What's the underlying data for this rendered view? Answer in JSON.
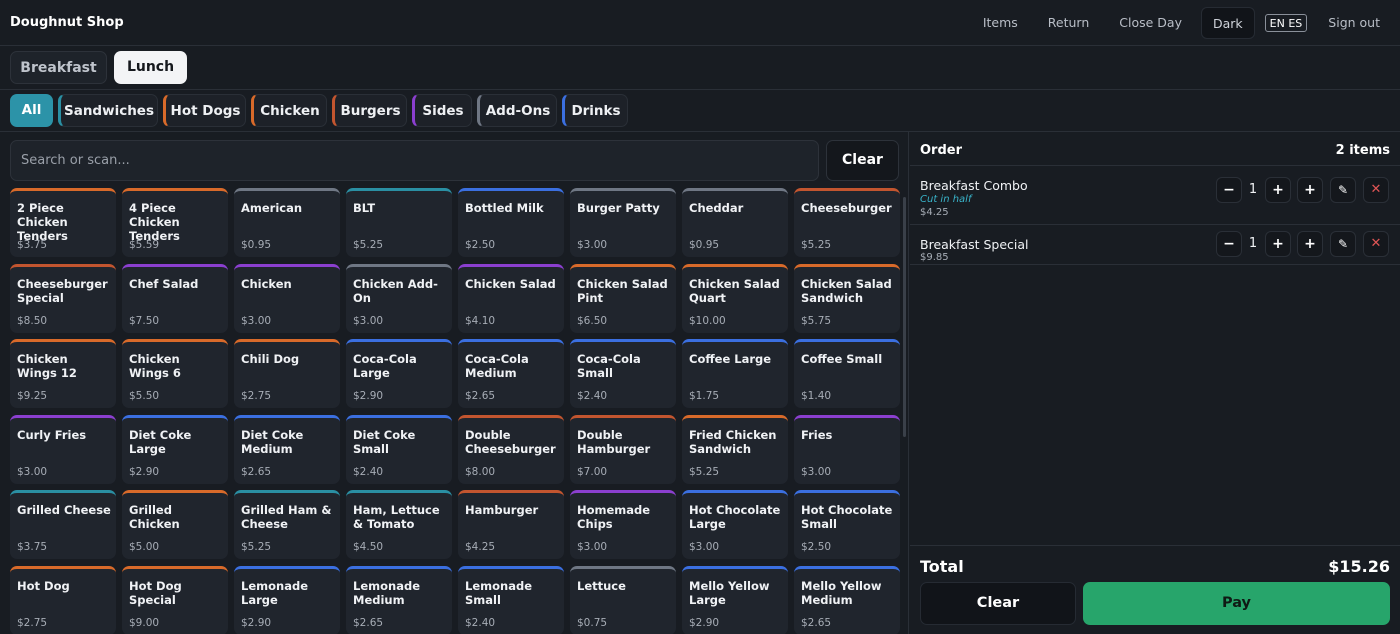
{
  "app": {
    "title": "Doughnut Shop"
  },
  "nav": {
    "items": "Items",
    "return": "Return",
    "close_day": "Close Day",
    "theme": "Dark",
    "lang": "EN ES",
    "sign_out": "Sign out"
  },
  "meals": {
    "breakfast": "Breakfast",
    "lunch": "Lunch"
  },
  "categories": [
    {
      "label": "All",
      "color": "#2c93a8"
    },
    {
      "label": "Sandwiches",
      "color": "#2a8fa3"
    },
    {
      "label": "Hot Dogs",
      "color": "#d86a2a"
    },
    {
      "label": "Chicken",
      "color": "#d86a2a"
    },
    {
      "label": "Burgers",
      "color": "#c2552f"
    },
    {
      "label": "Sides",
      "color": "#8b3fcf"
    },
    {
      "label": "Add-Ons",
      "color": "#6f7784"
    },
    {
      "label": "Drinks",
      "color": "#3b6fe0"
    }
  ],
  "search": {
    "placeholder": "Search or scan...",
    "clear_label": "Clear"
  },
  "colors": {
    "sandwich": "#2a8fa3",
    "chicken": "#d86a2a",
    "burger": "#c2552f",
    "side": "#8b3fcf",
    "addon": "#6f7784",
    "drink": "#3b6fe0",
    "pay": "#27a56b",
    "remove": "#e05555"
  },
  "products": [
    {
      "name": "2 Piece Chicken Tenders",
      "price": "$3.75",
      "cat": "chicken"
    },
    {
      "name": "4 Piece Chicken Tenders",
      "price": "$5.59",
      "cat": "chicken"
    },
    {
      "name": "American",
      "price": "$0.95",
      "cat": "addon"
    },
    {
      "name": "BLT",
      "price": "$5.25",
      "cat": "sandwich"
    },
    {
      "name": "Bottled Milk",
      "price": "$2.50",
      "cat": "drink"
    },
    {
      "name": "Burger Patty",
      "price": "$3.00",
      "cat": "addon"
    },
    {
      "name": "Cheddar",
      "price": "$0.95",
      "cat": "addon"
    },
    {
      "name": "Cheeseburger",
      "price": "$5.25",
      "cat": "burger"
    },
    {
      "name": "Cheeseburger Special",
      "price": "$8.50",
      "cat": "burger"
    },
    {
      "name": "Chef Salad",
      "price": "$7.50",
      "cat": "side"
    },
    {
      "name": "Chicken",
      "price": "$3.00",
      "cat": "side"
    },
    {
      "name": "Chicken Add-On",
      "price": "$3.00",
      "cat": "addon"
    },
    {
      "name": "Chicken Salad",
      "price": "$4.10",
      "cat": "side"
    },
    {
      "name": "Chicken Salad Pint",
      "price": "$6.50",
      "cat": "chicken"
    },
    {
      "name": "Chicken Salad Quart",
      "price": "$10.00",
      "cat": "chicken"
    },
    {
      "name": "Chicken Salad Sandwich",
      "price": "$5.75",
      "cat": "chicken"
    },
    {
      "name": "Chicken Wings 12",
      "price": "$9.25",
      "cat": "chicken"
    },
    {
      "name": "Chicken Wings 6",
      "price": "$5.50",
      "cat": "chicken"
    },
    {
      "name": "Chili Dog",
      "price": "$2.75",
      "cat": "chicken"
    },
    {
      "name": "Coca-Cola Large",
      "price": "$2.90",
      "cat": "drink"
    },
    {
      "name": "Coca-Cola Medium",
      "price": "$2.65",
      "cat": "drink"
    },
    {
      "name": "Coca-Cola Small",
      "price": "$2.40",
      "cat": "drink"
    },
    {
      "name": "Coffee Large",
      "price": "$1.75",
      "cat": "drink"
    },
    {
      "name": "Coffee Small",
      "price": "$1.40",
      "cat": "drink"
    },
    {
      "name": "Curly Fries",
      "price": "$3.00",
      "cat": "side"
    },
    {
      "name": "Diet Coke Large",
      "price": "$2.90",
      "cat": "drink"
    },
    {
      "name": "Diet Coke Medium",
      "price": "$2.65",
      "cat": "drink"
    },
    {
      "name": "Diet Coke Small",
      "price": "$2.40",
      "cat": "drink"
    },
    {
      "name": "Double Cheeseburger",
      "price": "$8.00",
      "cat": "burger"
    },
    {
      "name": "Double Hamburger",
      "price": "$7.00",
      "cat": "burger"
    },
    {
      "name": "Fried Chicken Sandwich",
      "price": "$5.25",
      "cat": "chicken"
    },
    {
      "name": "Fries",
      "price": "$3.00",
      "cat": "side"
    },
    {
      "name": "Grilled Cheese",
      "price": "$3.75",
      "cat": "sandwich"
    },
    {
      "name": "Grilled Chicken",
      "price": "$5.00",
      "cat": "chicken"
    },
    {
      "name": "Grilled Ham & Cheese",
      "price": "$5.25",
      "cat": "sandwich"
    },
    {
      "name": "Ham, Lettuce & Tomato",
      "price": "$4.50",
      "cat": "sandwich"
    },
    {
      "name": "Hamburger",
      "price": "$4.25",
      "cat": "burger"
    },
    {
      "name": "Homemade Chips",
      "price": "$3.00",
      "cat": "side"
    },
    {
      "name": "Hot Chocolate Large",
      "price": "$3.00",
      "cat": "drink"
    },
    {
      "name": "Hot Chocolate Small",
      "price": "$2.50",
      "cat": "drink"
    },
    {
      "name": "Hot Dog",
      "price": "$2.75",
      "cat": "chicken"
    },
    {
      "name": "Hot Dog Special",
      "price": "$9.00",
      "cat": "chicken"
    },
    {
      "name": "Lemonade Large",
      "price": "$2.90",
      "cat": "drink"
    },
    {
      "name": "Lemonade Medium",
      "price": "$2.65",
      "cat": "drink"
    },
    {
      "name": "Lemonade Small",
      "price": "$2.40",
      "cat": "drink"
    },
    {
      "name": "Lettuce",
      "price": "$0.75",
      "cat": "addon"
    },
    {
      "name": "Mello Yellow Large",
      "price": "$2.90",
      "cat": "drink"
    },
    {
      "name": "Mello Yellow Medium",
      "price": "$2.65",
      "cat": "drink"
    }
  ],
  "order": {
    "title": "Order",
    "count": "2 items",
    "lines": [
      {
        "name": "Breakfast Combo",
        "note": "Cut in half",
        "price": "$4.25",
        "qty": "1"
      },
      {
        "name": "Breakfast Special",
        "note": "",
        "price": "$9.85",
        "qty": "1"
      }
    ],
    "total_label": "Total",
    "total": "$15.26",
    "clear_label": "Clear",
    "pay_label": "Pay"
  }
}
